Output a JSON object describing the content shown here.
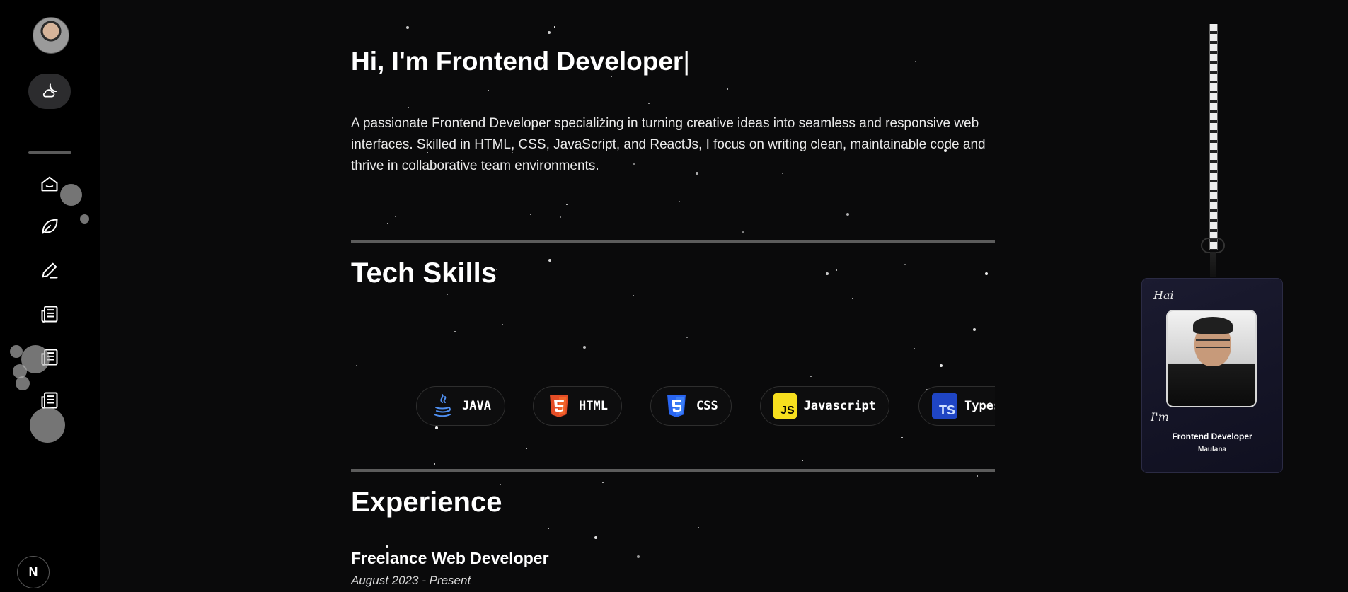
{
  "hero": {
    "title": "Hi, I'm Frontend Developer",
    "caret": "|",
    "description": "A passionate Frontend Developer specializing in turning creative ideas into seamless and responsive web interfaces. Skilled in HTML, CSS, JavaScript, and ReactJs, I focus on writing clean, maintainable code and thrive in collaborative team environments."
  },
  "skills": {
    "title": "Tech Skills",
    "items": [
      {
        "label": "JAVA",
        "icon": "java-icon"
      },
      {
        "label": "HTML",
        "icon": "html5-icon"
      },
      {
        "label": "CSS",
        "icon": "css3-icon"
      },
      {
        "label": "Javascript",
        "icon": "javascript-icon"
      },
      {
        "label": "Types",
        "icon": "typescript-icon"
      }
    ]
  },
  "experience": {
    "title": "Experience",
    "job_title": "Freelance Web Developer",
    "job_period": "August 2023 - Present"
  },
  "id_card": {
    "greeting": "Hai",
    "intro": "I'm",
    "role": "Frontend Developer",
    "name": "Maulana"
  },
  "sidebar": {
    "items": [
      "home-icon",
      "leaf-icon",
      "pen-icon",
      "newspaper-icon",
      "newspaper-icon",
      "newspaper-icon"
    ],
    "badge": "N"
  },
  "colors": {
    "background": "#0a0a0b",
    "sidebar": "#000000",
    "html": "#e44d26",
    "css": "#2965f1",
    "javascript": "#f7df1e",
    "typescript": "#3178c6"
  }
}
